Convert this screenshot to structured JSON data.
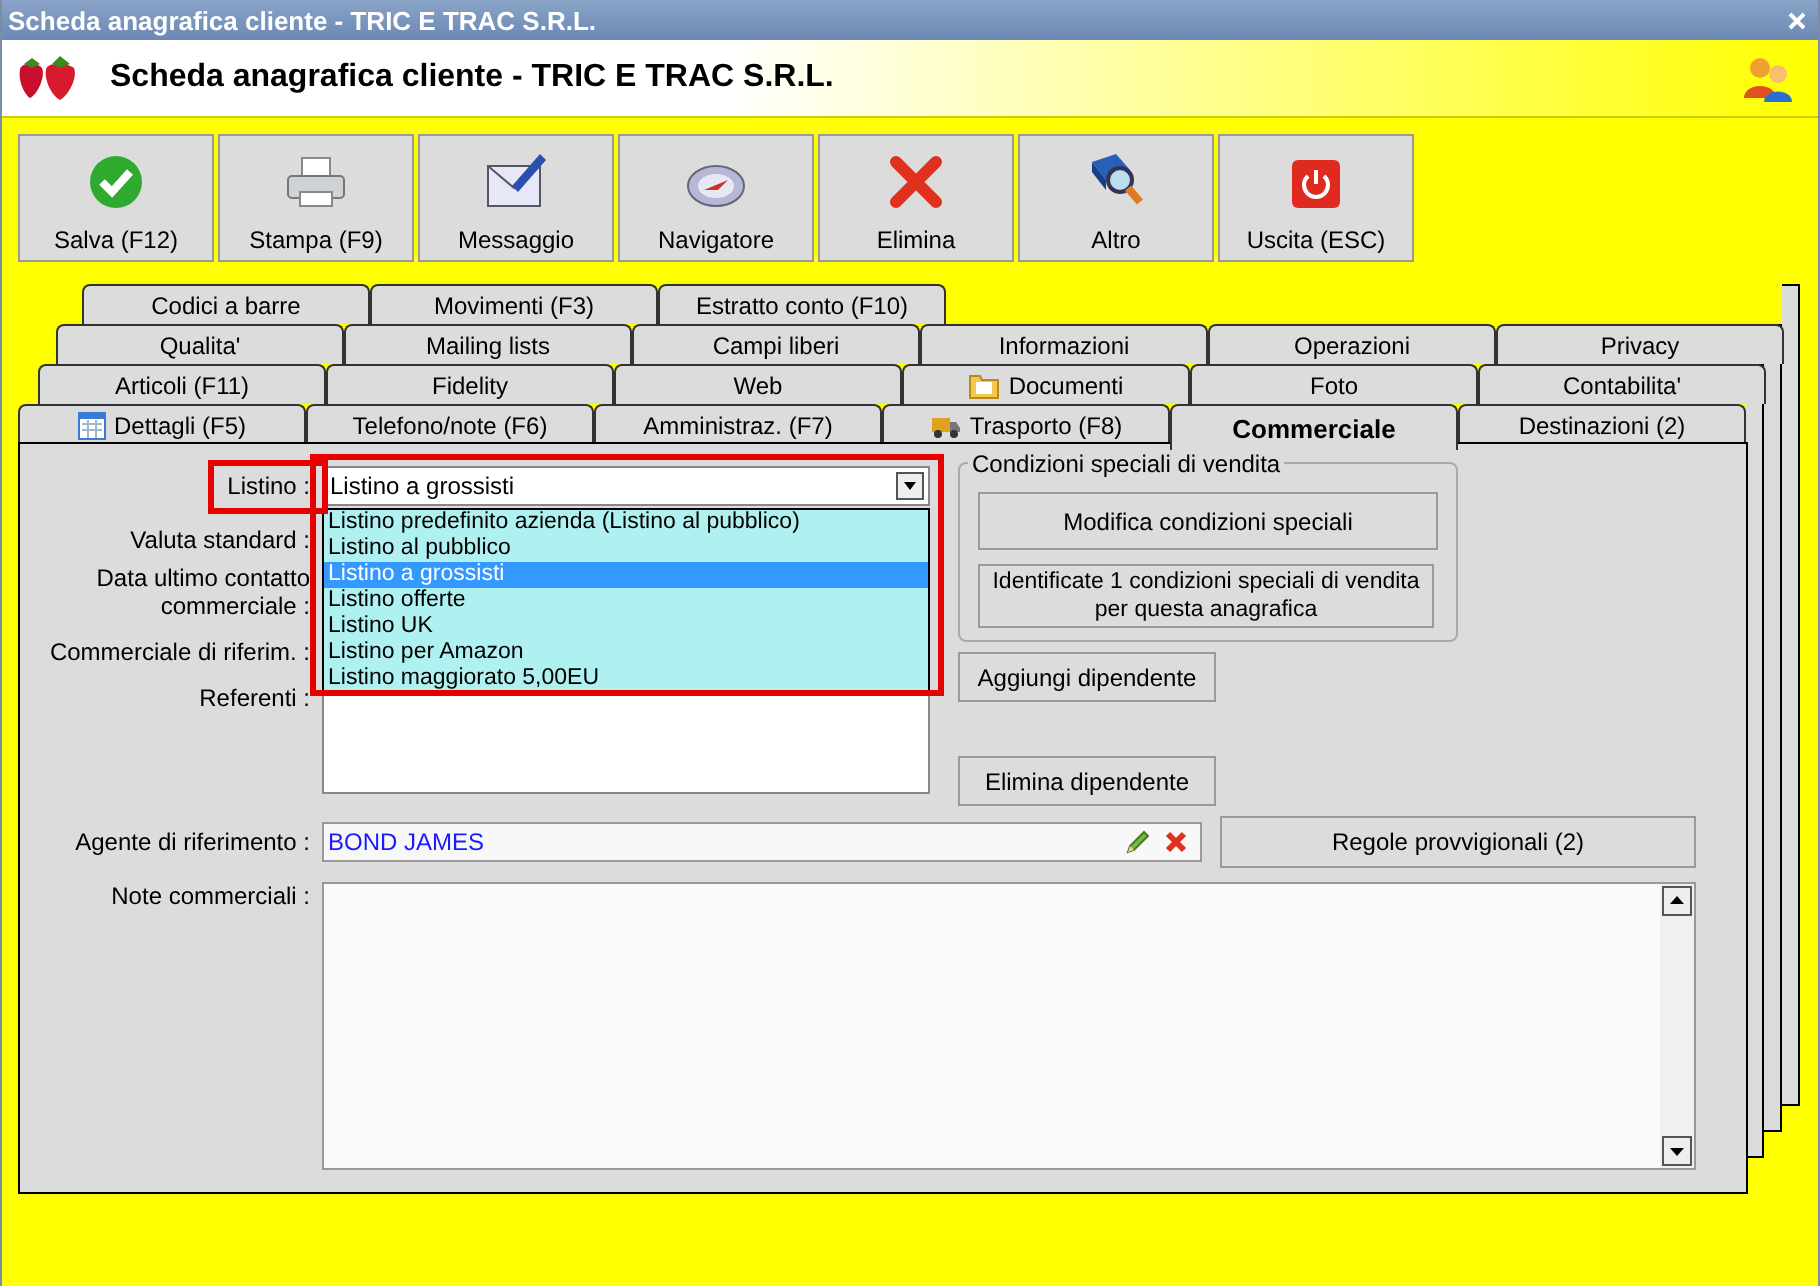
{
  "window": {
    "title": "Scheda anagrafica cliente - TRIC E TRAC S.R.L."
  },
  "header": {
    "title": "Scheda anagrafica cliente - TRIC E TRAC S.R.L."
  },
  "toolbar": [
    {
      "label": "Salva (F12)",
      "kind": "save"
    },
    {
      "label": "Stampa (F9)",
      "kind": "print"
    },
    {
      "label": "Messaggio",
      "kind": "message"
    },
    {
      "label": "Navigatore",
      "kind": "navigator"
    },
    {
      "label": "Elimina",
      "kind": "delete"
    },
    {
      "label": "Altro",
      "kind": "more"
    },
    {
      "label": "Uscita (ESC)",
      "kind": "exit"
    }
  ],
  "tab_rows": [
    [
      {
        "label": "Codici a barre",
        "selected": false
      },
      {
        "label": "Movimenti (F3)",
        "selected": false
      },
      {
        "label": "Estratto conto (F10)",
        "selected": false
      }
    ],
    [
      {
        "label": "Qualita'",
        "selected": false
      },
      {
        "label": "Mailing lists",
        "selected": false
      },
      {
        "label": "Campi liberi",
        "selected": false
      },
      {
        "label": "Informazioni",
        "selected": false
      },
      {
        "label": "Operazioni",
        "selected": false
      },
      {
        "label": "Privacy",
        "selected": false
      }
    ],
    [
      {
        "label": "Articoli (F11)",
        "selected": false
      },
      {
        "label": "Fidelity",
        "selected": false
      },
      {
        "label": "Web",
        "selected": false
      },
      {
        "label": "Documenti",
        "selected": false,
        "kind": "folder"
      },
      {
        "label": "Foto",
        "selected": false
      },
      {
        "label": "Contabilita'",
        "selected": false
      }
    ],
    [
      {
        "label": "Dettagli (F5)",
        "selected": false,
        "kind": "calendar"
      },
      {
        "label": "Telefono/note (F6)",
        "selected": false
      },
      {
        "label": "Amministraz. (F7)",
        "selected": false
      },
      {
        "label": "Trasporto (F8)",
        "selected": false,
        "kind": "truck"
      },
      {
        "label": "Commerciale",
        "selected": true
      },
      {
        "label": "Destinazioni (2)",
        "selected": false
      }
    ]
  ],
  "listino": {
    "label": "Listino :",
    "value": "Listino a grossisti",
    "highlighted": true,
    "options": [
      {
        "label": "Listino predefinito azienda (Listino al pubblico)",
        "selected": false
      },
      {
        "label": "Listino al pubblico",
        "selected": false
      },
      {
        "label": "Listino a grossisti",
        "selected": true
      },
      {
        "label": "Listino offerte",
        "selected": false
      },
      {
        "label": "Listino UK",
        "selected": false
      },
      {
        "label": "Listino per Amazon",
        "selected": false
      },
      {
        "label": "Listino maggiorato 5,00EU",
        "selected": false
      }
    ]
  },
  "labels": {
    "valuta": "Valuta standard :",
    "data": "Data ultimo contatto commerciale :",
    "commerciale": "Commerciale di riferim. :",
    "referenti": "Referenti :"
  },
  "special_conditions": {
    "title": "Condizioni speciali di vendita",
    "button": "Modifica condizioni speciali",
    "info": "Identificate 1 condizioni speciali di vendita per questa anagrafica"
  },
  "referenti_buttons": [
    "Aggiungi dipendente",
    "Elimina dipendente"
  ],
  "agente": {
    "label": "Agente di riferimento :",
    "value": "BOND JAMES",
    "button": "Regole provvigionali (2)"
  },
  "note": {
    "label": "Note commerciali :"
  }
}
